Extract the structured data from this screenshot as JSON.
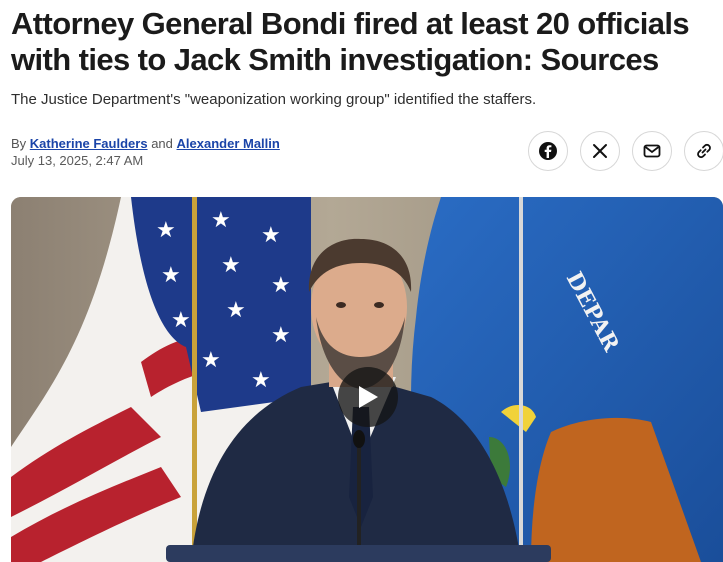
{
  "article": {
    "headline": "Attorney General Bondi fired at least 20 officials with ties to Jack Smith investigation: Sources",
    "subhead": "The Justice Department's \"weaponization working group\" identified the staffers.",
    "byline": {
      "prefix": "By",
      "author1": "Katherine Faulders",
      "conjunction": "and",
      "author2": "Alexander Mallin"
    },
    "date": "July 13, 2025, 2:47 AM"
  },
  "share": [
    {
      "icon": "facebook-icon",
      "label": "Share on Facebook"
    },
    {
      "icon": "x-icon",
      "label": "Share on X"
    },
    {
      "icon": "mail-icon",
      "label": "Share via email"
    },
    {
      "icon": "link-icon",
      "label": "Copy link"
    }
  ],
  "media": {
    "flag_text": "DEPAR",
    "play_icon": "play-icon"
  },
  "colors": {
    "link": "#1a44a8",
    "flag_blue": "#1f5fb5",
    "flag_red": "#b8222e",
    "suit": "#1f2a44"
  }
}
